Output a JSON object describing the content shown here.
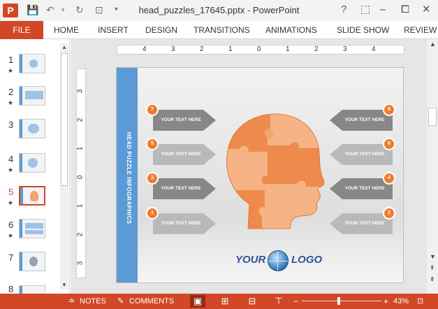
{
  "app": {
    "icon_letter": "P",
    "title": "head_puzzles_17645.pptx - PowerPoint"
  },
  "window_buttons": [
    "?",
    "⬚",
    "–",
    "⧠",
    "✕"
  ],
  "ribbon": {
    "file": "FILE",
    "tabs": [
      "HOME",
      "INSERT",
      "DESIGN",
      "TRANSITIONS",
      "ANIMATIONS",
      "SLIDE SHOW",
      "REVIEW"
    ]
  },
  "thumbnails": [
    {
      "num": "1",
      "star": "★"
    },
    {
      "num": "2",
      "star": "★"
    },
    {
      "num": "3",
      "star": ""
    },
    {
      "num": "4",
      "star": "★"
    },
    {
      "num": "5",
      "star": "★"
    },
    {
      "num": "6",
      "star": "★"
    },
    {
      "num": "7",
      "star": ""
    },
    {
      "num": "8",
      "star": ""
    }
  ],
  "selected_slide": "5",
  "ruler": {
    "h": [
      "4",
      "3",
      "2",
      "1",
      "0",
      "1",
      "2",
      "3",
      "4"
    ],
    "v": [
      "3",
      "2",
      "1",
      "0",
      "1",
      "2",
      "3"
    ]
  },
  "slide": {
    "side_title": "HEAD PUZZLE INFOGRAPHICS",
    "boxes_left": [
      {
        "n": "7",
        "text": "YOUR TEXT HERE"
      },
      {
        "n": "5",
        "text": "YOUR TEXT HERE"
      },
      {
        "n": "3",
        "text": "YOUR TEXT HERE"
      },
      {
        "n": "1",
        "text": "YOUR TEXT HERE"
      }
    ],
    "boxes_right": [
      {
        "n": "8",
        "text": "YOUR TEXT HERE"
      },
      {
        "n": "6",
        "text": "YOUR TEXT HERE"
      },
      {
        "n": "4",
        "text": "YOUR TEXT HERE"
      },
      {
        "n": "2",
        "text": "YOUR TEXT HERE"
      }
    ],
    "logo_left": "YOUR",
    "logo_right": "LOGO"
  },
  "status": {
    "notes": "NOTES",
    "comments": "COMMENTS",
    "zoom": "43%"
  },
  "colors": {
    "accent": "#d24726",
    "orange": "#ed7d31",
    "blue": "#5b9bd5"
  }
}
